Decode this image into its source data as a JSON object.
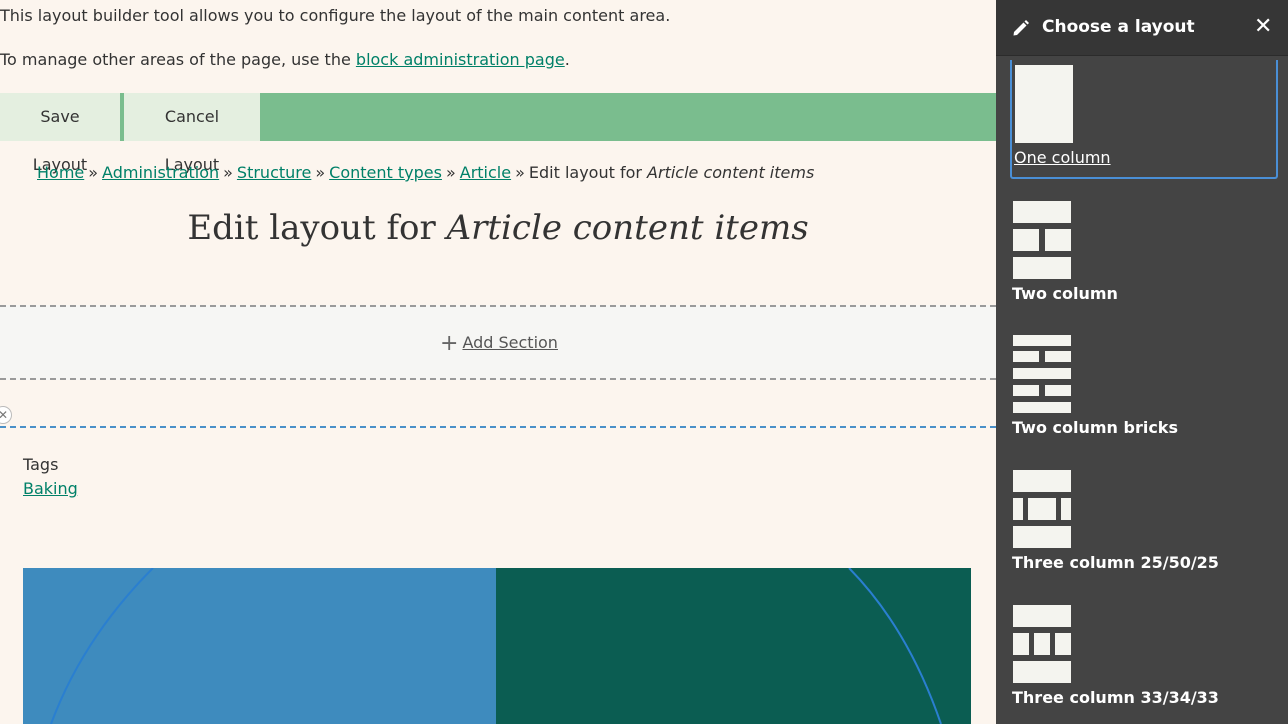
{
  "intro": {
    "line1": "This layout builder tool allows you to configure the layout of the main content area.",
    "line2_prefix": "To manage other areas of the page, use the ",
    "line2_link": "block administration page",
    "line2_suffix": "."
  },
  "actions": {
    "save_label": "Save Layout",
    "cancel_label": "Cancel Layout"
  },
  "breadcrumb": {
    "items": [
      "Home",
      "Administration",
      "Structure",
      "Content types",
      "Article"
    ],
    "separator": "»",
    "current_prefix": "Edit layout for ",
    "current_em": "Article content items"
  },
  "page_title": {
    "prefix": "Edit layout for ",
    "em": "Article content items"
  },
  "add_section": {
    "icon": "+",
    "label": "Add Section"
  },
  "section": {
    "remove_icon": "✕"
  },
  "field": {
    "tags_label": "Tags",
    "tags_value": "Baking"
  },
  "hero": {
    "left_color": "#3e8bbe",
    "right_color": "#0b5d52"
  },
  "panel": {
    "title": "Choose a layout",
    "close_icon": "✕",
    "layouts": [
      {
        "label": "One column",
        "icon": "layout-one-column-icon",
        "selected": true
      },
      {
        "label": "Two column",
        "icon": "layout-two-column-icon"
      },
      {
        "label": "Two column bricks",
        "icon": "layout-two-column-bricks-icon"
      },
      {
        "label": "Three column 25/50/25",
        "icon": "layout-three-column-25-50-25-icon"
      },
      {
        "label": "Three column 33/34/33",
        "icon": "layout-three-column-33-34-33-icon"
      }
    ]
  },
  "colors": {
    "page_bg": "#fcf5ee",
    "link": "#008068",
    "action_bar": "#7abd8e",
    "panel_bg": "#444444",
    "selection": "#4a8fd6"
  }
}
